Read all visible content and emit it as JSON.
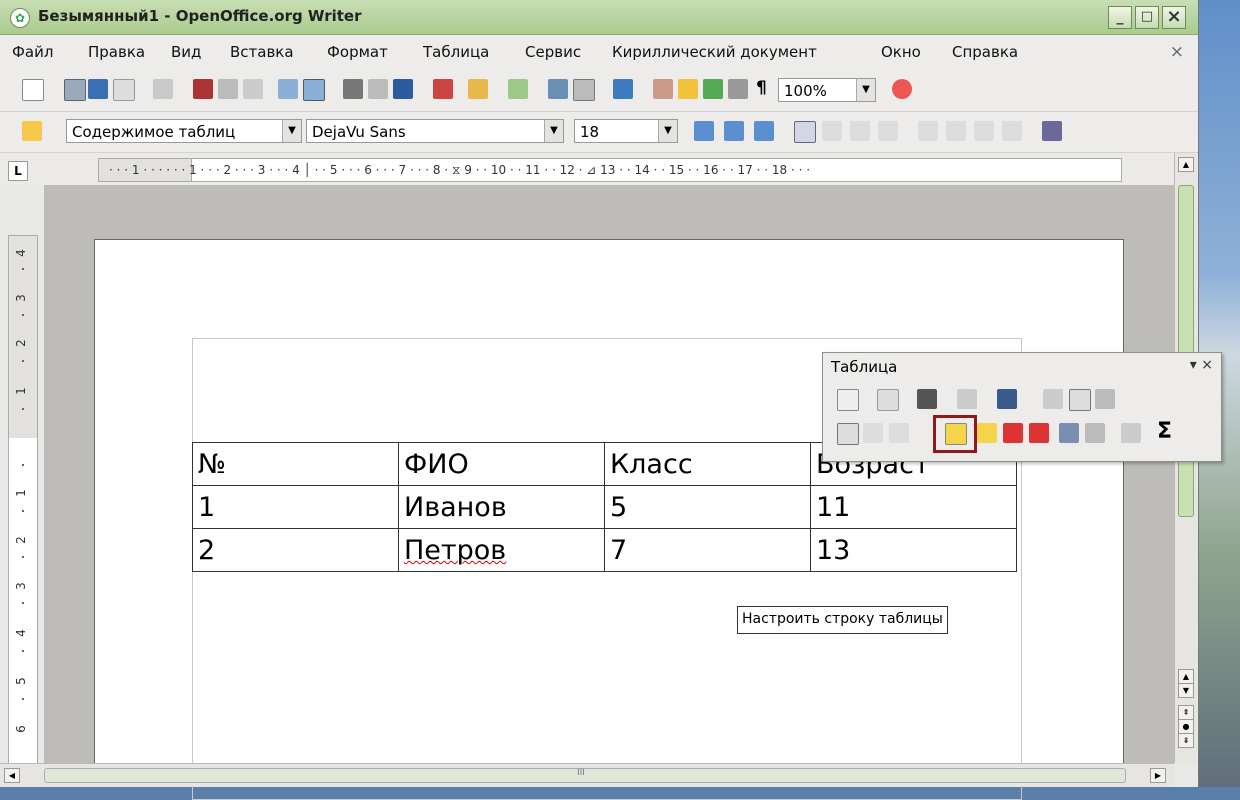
{
  "window": {
    "title": "Безымянный1 - OpenOffice.org Writer",
    "minimize": "_",
    "maximize": "□",
    "close": "×"
  },
  "menu": {
    "items": [
      "Файл",
      "Правка",
      "Вид",
      "Вставка",
      "Формат",
      "Таблица",
      "Сервис",
      "Кириллический документ",
      "Окно",
      "Справка"
    ],
    "close": "×"
  },
  "standard_toolbar": {
    "zoom": "100%",
    "para_mark": "¶"
  },
  "format_toolbar": {
    "style": "Содержимое таблиц",
    "font": "DejaVu Sans",
    "size": "18"
  },
  "ruler": {
    "horizontal": "· · · 1 · · ·   · · · 1 · · · 2 · · · 3 · · · 4 │ · · 5 · · · 6 · · · 7 · · · 8 · ⧖ 9 · · 10 · · 11 · · 12 · ⊿ 13 · · 14 · · 15 · · 16 · · 17 · · 18 · · ·",
    "vertical_marks": [
      "4",
      "3",
      "2",
      "1",
      "1",
      "2",
      "3",
      "4",
      "5",
      "6"
    ],
    "corner": "L"
  },
  "document": {
    "table": [
      [
        "№",
        "ФИО",
        "Класс",
        "Возраст"
      ],
      [
        "1",
        "Иванов",
        "5",
        "11"
      ],
      [
        "2",
        "Петров",
        "7",
        "13"
      ]
    ]
  },
  "table_toolbar": {
    "title": "Таблица",
    "controls": "▾ ×",
    "sum": "Σ"
  },
  "tooltip": "Настроить строку таблицы",
  "hscroll_mark": "III"
}
